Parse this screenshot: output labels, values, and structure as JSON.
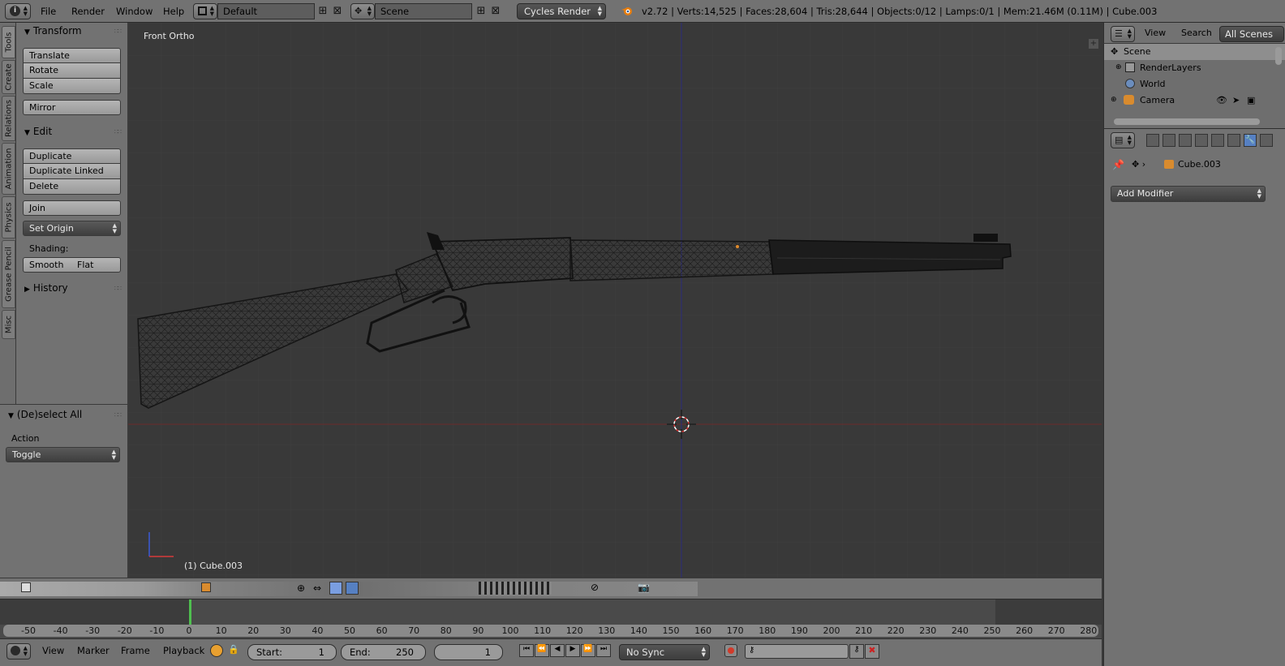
{
  "topbar": {
    "menus": [
      "File",
      "Render",
      "Window",
      "Help"
    ],
    "layout_name": "Default",
    "scene_name": "Scene",
    "render_engine": "Cycles Render",
    "stats": "v2.72 | Verts:14,525 | Faces:28,604 | Tris:28,644 | Objects:0/12 | Lamps:0/1 | Mem:21.46M (0.11M) | Cube.003"
  },
  "tabs": [
    "Tools",
    "Create",
    "Relations",
    "Animation",
    "Physics",
    "Grease Pencil",
    "Misc"
  ],
  "toolshelf": {
    "transform_header": "Transform",
    "translate": "Translate",
    "rotate": "Rotate",
    "scale": "Scale",
    "mirror": "Mirror",
    "edit_header": "Edit",
    "duplicate": "Duplicate",
    "duplicate_linked": "Duplicate Linked",
    "delete": "Delete",
    "join": "Join",
    "set_origin": "Set Origin",
    "shading_label": "Shading:",
    "smooth": "Smooth",
    "flat": "Flat",
    "history_header": "History"
  },
  "operator": {
    "header": "(De)select All",
    "action_label": "Action",
    "action_value": "Toggle"
  },
  "viewport": {
    "view_name": "Front Ortho",
    "object_label": "(1) Cube.003"
  },
  "outliner": {
    "menus": [
      "View",
      "Search",
      "All Scenes"
    ],
    "rows": [
      "Scene",
      "RenderLayers",
      "World",
      "Camera"
    ]
  },
  "properties": {
    "object_name": "Cube.003",
    "add_modifier": "Add Modifier"
  },
  "timeline": {
    "ticks": [
      "-50",
      "-40",
      "-30",
      "-20",
      "-10",
      "0",
      "10",
      "20",
      "30",
      "40",
      "50",
      "60",
      "70",
      "80",
      "90",
      "100",
      "110",
      "120",
      "130",
      "140",
      "150",
      "160",
      "170",
      "180",
      "190",
      "200",
      "210",
      "220",
      "230",
      "240",
      "250",
      "260",
      "270",
      "280"
    ],
    "menus": [
      "View",
      "Marker",
      "Frame",
      "Playback"
    ],
    "start_label": "Start:",
    "start_value": "1",
    "end_label": "End:",
    "end_value": "250",
    "current_frame": "1",
    "sync": "No Sync"
  },
  "colors": {
    "ui_gray": "#727272",
    "viewport_bg": "#393939",
    "x_axis": "#7a2a2a",
    "z_axis": "#2a2a8a",
    "current_frame_marker": "#4fbf4f",
    "active_tab": "#5680c2"
  }
}
